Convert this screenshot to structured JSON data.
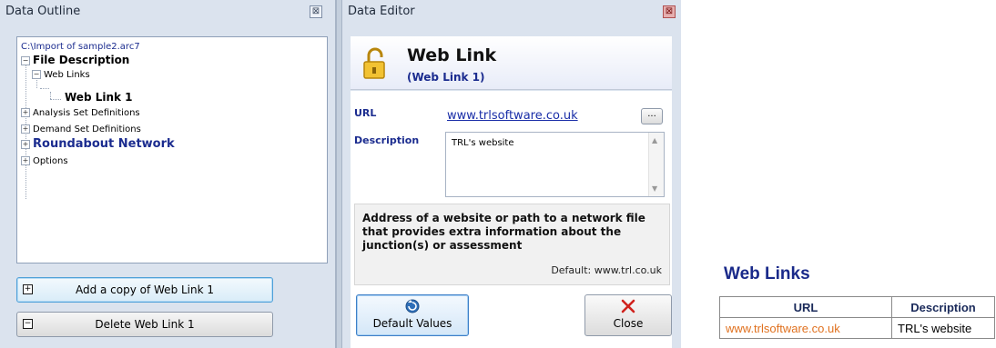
{
  "outline": {
    "title": "Data Outline",
    "tree": {
      "root": "C:\\Import of sample2.arc7",
      "file_description": "File Description",
      "web_links": "Web Links",
      "web_link_1": "Web Link 1",
      "analysis_set": "Analysis Set Definitions",
      "demand_set": "Demand Set Definitions",
      "roundabout": "Roundabout Network",
      "options": "Options"
    },
    "add_copy_label": "Add a copy of Web Link 1",
    "delete_label": "Delete Web Link 1"
  },
  "editor": {
    "title": "Data Editor",
    "header_title": "Web Link",
    "header_subtitle": "(Web Link 1)",
    "url_label": "URL",
    "url_value": "www.trlsoftware.co.uk",
    "browse_label": "...",
    "description_label": "Description",
    "description_value": "TRL's website",
    "help_text": "Address of a website or path to a network file that provides extra information about the junction(s) or assessment",
    "default_text": "Default: www.trl.co.uk",
    "default_values_label": "Default Values",
    "close_label": "Close"
  },
  "report": {
    "title": "Web Links",
    "columns": [
      "URL",
      "Description"
    ],
    "rows": [
      {
        "url": "www.trlsoftware.co.uk",
        "description": "TRL's website"
      }
    ]
  },
  "colors": {
    "panel_bg": "#dbe3ee",
    "link_blue": "#1a2ea8",
    "report_url_orange": "#e0711f"
  }
}
